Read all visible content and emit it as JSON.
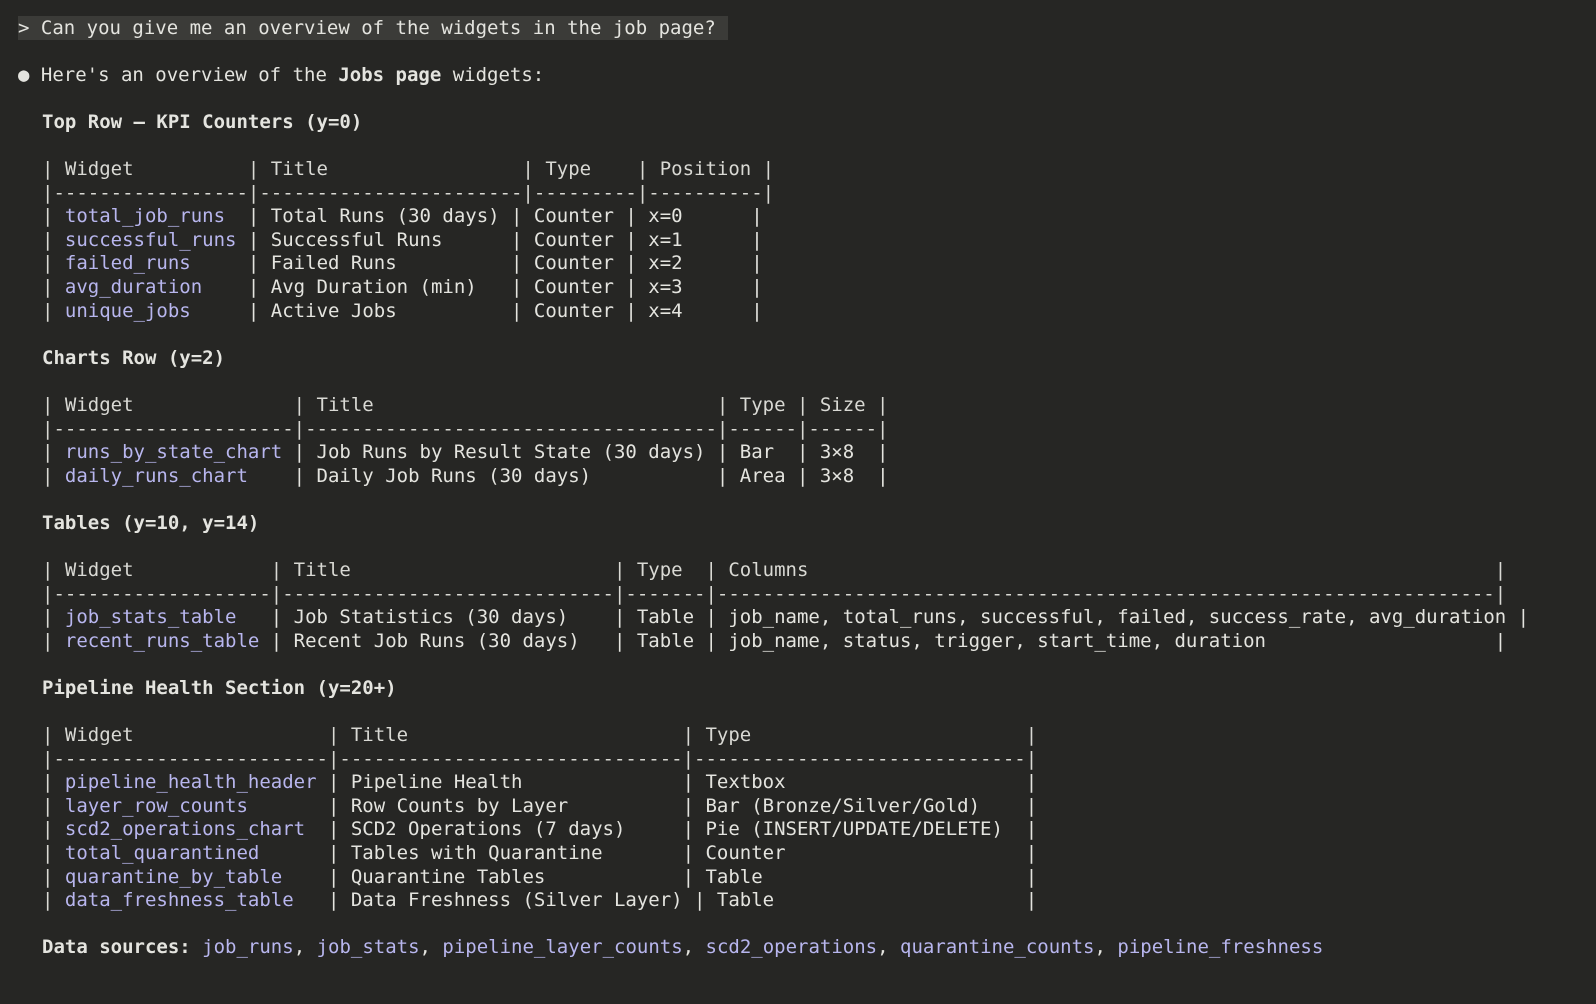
{
  "prompt": {
    "marker": ">",
    "text": "Can you give me an overview of the widgets in the job page?"
  },
  "response": {
    "bullet": "●",
    "intro_before": "Here's an overview of the ",
    "intro_bold": "Jobs page",
    "intro_after": " widgets:"
  },
  "sections": [
    {
      "heading": "Top Row – KPI Counters (y=0)",
      "header_line": "| Widget          | Title                 | Type    | Position |",
      "separator": "|-----------------|-----------------------|---------|----------|",
      "rows": [
        {
          "pre": "| ",
          "widget": "total_job_runs",
          "post": "  | Total Runs (30 days) | Counter | x=0      |"
        },
        {
          "pre": "| ",
          "widget": "successful_runs",
          "post": " | Successful Runs      | Counter | x=1      |"
        },
        {
          "pre": "| ",
          "widget": "failed_runs",
          "post": "     | Failed Runs          | Counter | x=2      |"
        },
        {
          "pre": "| ",
          "widget": "avg_duration",
          "post": "    | Avg Duration (min)   | Counter | x=3      |"
        },
        {
          "pre": "| ",
          "widget": "unique_jobs",
          "post": "     | Active Jobs          | Counter | x=4      |"
        }
      ]
    },
    {
      "heading": "Charts Row (y=2)",
      "header_line": "| Widget              | Title                              | Type | Size |",
      "separator": "|---------------------|------------------------------------|------|------|",
      "rows": [
        {
          "pre": "| ",
          "widget": "runs_by_state_chart",
          "post": " | Job Runs by Result State (30 days) | Bar  | 3×8  |"
        },
        {
          "pre": "| ",
          "widget": "daily_runs_chart",
          "post": "    | Daily Job Runs (30 days)           | Area | 3×8  |"
        }
      ]
    },
    {
      "heading": "Tables (y=10, y=14)",
      "header_line": "| Widget            | Title                       | Type  | Columns                                                            |",
      "separator": "|-------------------|-----------------------------|-------|--------------------------------------------------------------------|",
      "rows": [
        {
          "pre": "| ",
          "widget": "job_stats_table",
          "post": "   | Job Statistics (30 days)    | Table | job_name, total_runs, successful, failed, success_rate, avg_duration |"
        },
        {
          "pre": "| ",
          "widget": "recent_runs_table",
          "post": " | Recent Job Runs (30 days)   | Table | job_name, status, trigger, start_time, duration                    |"
        }
      ]
    },
    {
      "heading": "Pipeline Health Section (y=20+)",
      "header_line": "| Widget                 | Title                        | Type                        |",
      "separator": "|------------------------|------------------------------|-----------------------------|",
      "rows": [
        {
          "pre": "| ",
          "widget": "pipeline_health_header",
          "post": " | Pipeline Health              | Textbox                     |"
        },
        {
          "pre": "| ",
          "widget": "layer_row_counts",
          "post": "       | Row Counts by Layer          | Bar (Bronze/Silver/Gold)    |"
        },
        {
          "pre": "| ",
          "widget": "scd2_operations_chart",
          "post": "  | SCD2 Operations (7 days)     | Pie (INSERT/UPDATE/DELETE)  |"
        },
        {
          "pre": "| ",
          "widget": "total_quarantined",
          "post": "      | Tables with Quarantine       | Counter                     |"
        },
        {
          "pre": "| ",
          "widget": "quarantine_by_table",
          "post": "    | Quarantine Tables            | Table                       |"
        },
        {
          "pre": "| ",
          "widget": "data_freshness_table",
          "post": "   | Data Freshness (Silver Layer) | Table                      |"
        }
      ]
    }
  ],
  "data_sources": {
    "label": "Data sources:",
    "items": [
      "job_runs",
      "job_stats",
      "pipeline_layer_counts",
      "scd2_operations",
      "quarantine_counts",
      "pipeline_freshness"
    ]
  },
  "colors": {
    "background": "#262624",
    "text": "#e4e4df",
    "widget_name": "#b8b6ee",
    "prompt_highlight": "#3b3b38"
  }
}
